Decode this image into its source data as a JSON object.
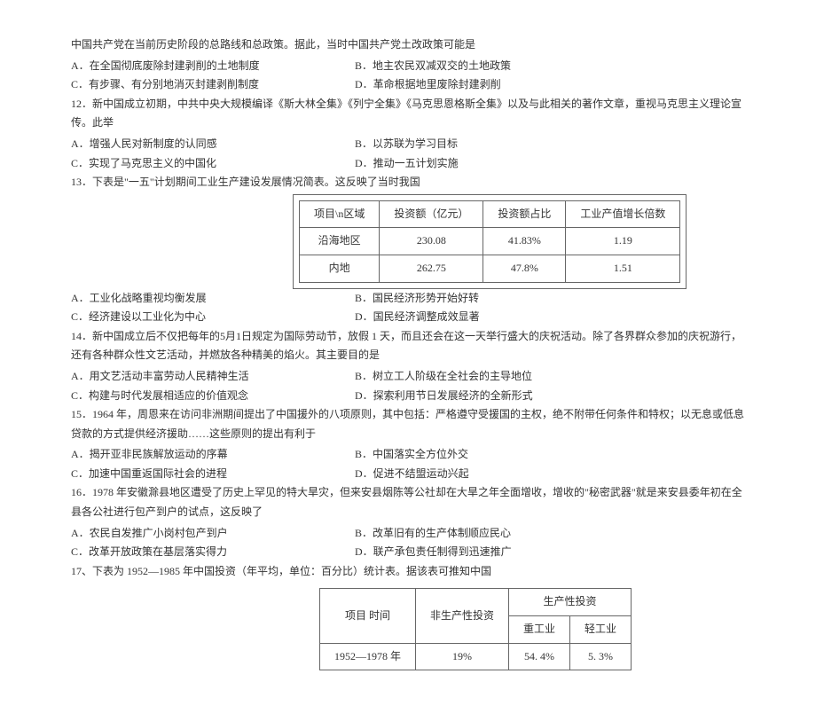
{
  "intro": "中国共产党在当前历史阶段的总路线和总政策。据此，当时中国共产党土改政策可能是",
  "q_intro_opts": {
    "a": "A．在全国彻底废除封建剥削的土地制度",
    "b": "B．地主农民双减双交的土地政策",
    "c": "C．有步骤、有分别地消灭封建剥削制度",
    "d": "D．革命根据地里废除封建剥削"
  },
  "q12": "12．新中国成立初期，中共中央大规模编译《斯大林全集》《列宁全集》《马克思恩格斯全集》以及与此相关的著作文章，重视马克思主义理论宣传。此举",
  "q12_opts": {
    "a": "A．增强人民对新制度的认同感",
    "b": "B．以苏联为学习目标",
    "c": "C．实现了马克思主义的中国化",
    "d": "D．推动一五计划实施"
  },
  "q13": "13．下表是\"一五\"计划期间工业生产建设发展情况简表。这反映了当时我国",
  "table1": {
    "h1": "项目\\n区域",
    "h2": "投资额（亿元）",
    "h3": "投资额占比",
    "h4": "工业产值增长倍数",
    "r1c1": "沿海地区",
    "r1c2": "230.08",
    "r1c3": "41.83%",
    "r1c4": "1.19",
    "r2c1": "内地",
    "r2c2": "262.75",
    "r2c3": "47.8%",
    "r2c4": "1.51"
  },
  "q13_opts": {
    "a": "A．工业化战略重视均衡发展",
    "b": "B．国民经济形势开始好转",
    "c": "C．经济建设以工业化为中心",
    "d": "D．国民经济调整成效显著"
  },
  "q14": "14．新中国成立后不仅把每年的5月1日规定为国际劳动节，放假 1 天，而且还会在这一天举行盛大的庆祝活动。除了各界群众参加的庆祝游行，还有各种群众性文艺活动，并燃放各种精美的焰火。其主要目的是",
  "q14_opts": {
    "a": "A．用文艺活动丰富劳动人民精神生活",
    "b": "B．树立工人阶级在全社会的主导地位",
    "c": "C．构建与时代发展相适应的价值观念",
    "d": "D．探索利用节日发展经济的全新形式"
  },
  "q15": "15．1964 年，周恩来在访问非洲期间提出了中国援外的八项原则，其中包括：严格遵守受援国的主权，绝不附带任何条件和特权；以无息或低息贷款的方式提供经济援助……这些原则的提出有利于",
  "q15_opts": {
    "a": "A．揭开亚非民族解放运动的序幕",
    "b": "B．中国落实全方位外交",
    "c": "C．加速中国重返国际社会的进程",
    "d": "D．促进不结盟运动兴起"
  },
  "q16": "16．1978 年安徽滁县地区遭受了历史上罕见的特大旱灾，但来安县烟陈等公社却在大旱之年全面增收，增收的\"秘密武器\"就是来安县委年初在全县各公社进行包产到户的试点，这反映了",
  "q16_opts": {
    "a": "A．农民自发推广小岗村包产到户",
    "b": "B．改革旧有的生产体制顺应民心",
    "c": "C．改革开放政策在基层落实得力",
    "d": "D．联产承包责任制得到迅速推广"
  },
  "q17": "17、下表为 1952—1985 年中国投资（年平均，单位：百分比）统计表。据该表可推知中国",
  "table2": {
    "h1": "项目\n时间",
    "h2": "非生产性投资",
    "h3": "生产性投资",
    "h3a": "重工业",
    "h3b": "轻工业",
    "r1c1": "1952—1978 年",
    "r1c2": "19%",
    "r1c3": "54. 4%",
    "r1c4": "5. 3%"
  }
}
